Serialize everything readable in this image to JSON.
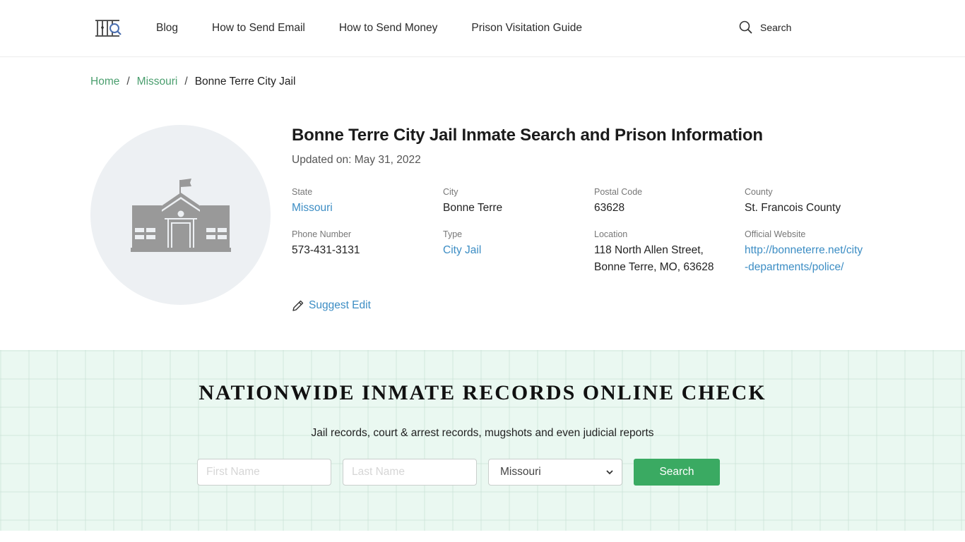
{
  "header": {
    "logo_alt": "jail bars search logo",
    "nav": [
      {
        "label": "Blog"
      },
      {
        "label": "How to Send Email"
      },
      {
        "label": "How to Send Money"
      },
      {
        "label": "Prison Visitation Guide"
      }
    ],
    "search_label": "Search"
  },
  "breadcrumb": {
    "items": [
      {
        "label": "Home"
      },
      {
        "label": "Missouri"
      }
    ],
    "separator": "/",
    "current": "Bonne Terre City Jail"
  },
  "facility": {
    "title": "Bonne Terre City Jail Inmate Search and Prison Information",
    "updated": "Updated on: May 31, 2022",
    "icon": "building-icon",
    "fields": [
      {
        "label": "State",
        "value": "Missouri",
        "link": true
      },
      {
        "label": "City",
        "value": "Bonne Terre",
        "link": false
      },
      {
        "label": "Postal Code",
        "value": "63628",
        "link": false
      },
      {
        "label": "County",
        "value": "St. Francois County",
        "link": false
      },
      {
        "label": "Phone Number",
        "value": "573-431-3131",
        "link": false
      },
      {
        "label": "Type",
        "value": "City Jail",
        "link": true
      },
      {
        "label": "Location",
        "value_line1": "118 North Allen Street,",
        "value_line2": "Bonne Terre, MO, 63628",
        "link": false
      },
      {
        "label": "Official Website",
        "value_line1": "http://bonneterre.net/city",
        "value_line2": "-departments/police/",
        "link": true
      }
    ],
    "suggest_edit": "Suggest Edit"
  },
  "search_band": {
    "title": "NATIONWIDE INMATE RECORDS ONLINE CHECK",
    "subtitle": "Jail records, court & arrest records, mugshots and even judicial reports",
    "first_name_placeholder": "First Name",
    "last_name_placeholder": "Last Name",
    "state_selected": "Missouri",
    "button_label": "Search"
  },
  "colors": {
    "link_green": "#4a9e6e",
    "link_blue": "#3c8dc4",
    "button_green": "#3aaa62",
    "band_bg": "#eaf8f1"
  }
}
